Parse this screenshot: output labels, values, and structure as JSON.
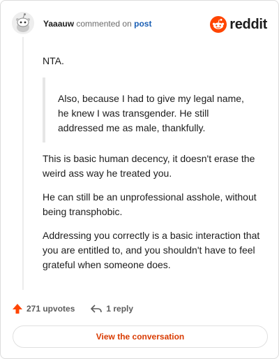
{
  "header": {
    "username": "Yaaauw",
    "action_text": "commented on",
    "post_link": "post",
    "brand_name": "reddit",
    "brand_color": "#ff4500"
  },
  "comment": {
    "paragraph_1": "NTA.",
    "quote": "Also, because I had to give my legal name, he knew I was transgender. He still addressed me as male, thankfully.",
    "paragraph_2": "This is basic human decency, it doesn't erase the weird ass way he treated you.",
    "paragraph_3": "He can still be an unprofessional asshole, without being transphobic.",
    "paragraph_4": "Addressing you correctly is a basic interaction that you are entitled to, and you shouldn't have to feel grateful when someone does."
  },
  "footer": {
    "upvotes_label": "271 upvotes",
    "replies_label": "1 reply",
    "upvote_icon": "upvote-arrow-icon",
    "reply_icon": "reply-arrow-icon"
  },
  "cta": {
    "view_label": "View the conversation"
  }
}
